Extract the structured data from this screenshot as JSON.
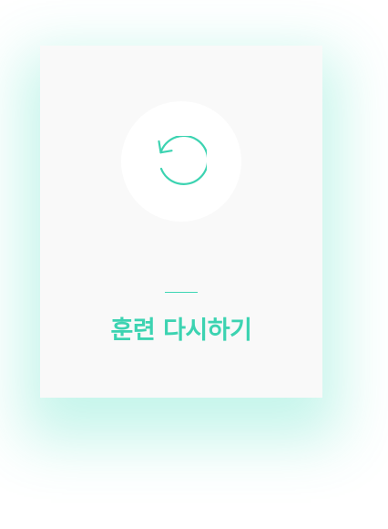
{
  "retry_card": {
    "label": "훈련 다시하기",
    "icon": "retry-icon"
  },
  "colors": {
    "accent": "#3cd3b1",
    "card_background": "#f9f9f9",
    "icon_background": "#ffffff",
    "glow": "#40debe"
  }
}
